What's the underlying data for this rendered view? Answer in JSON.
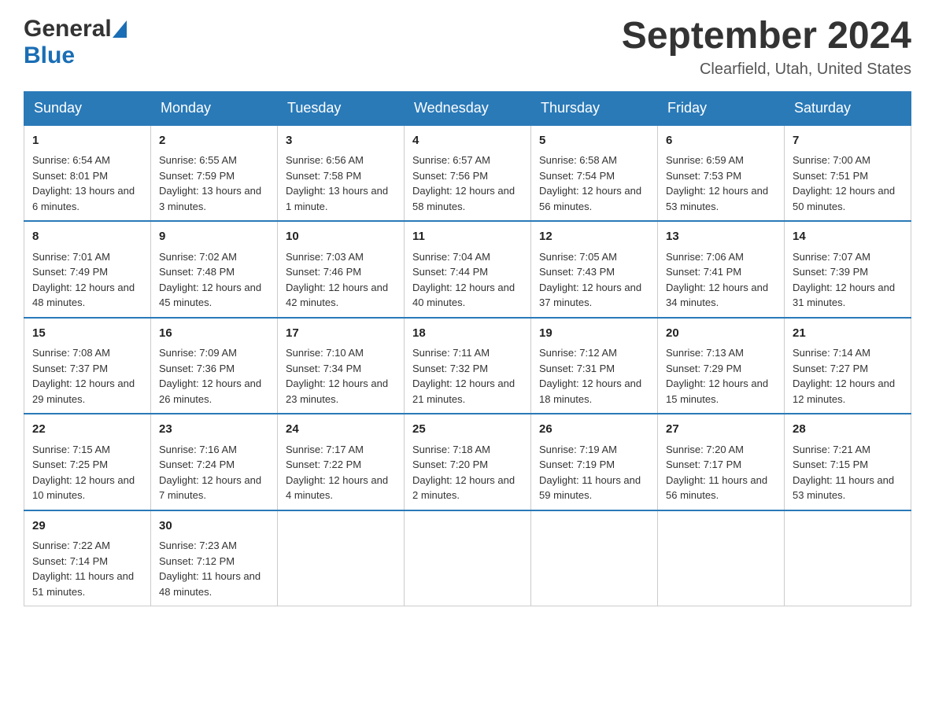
{
  "header": {
    "logo_general": "General",
    "logo_blue": "Blue",
    "title": "September 2024",
    "subtitle": "Clearfield, Utah, United States"
  },
  "days_of_week": [
    "Sunday",
    "Monday",
    "Tuesday",
    "Wednesday",
    "Thursday",
    "Friday",
    "Saturday"
  ],
  "weeks": [
    [
      {
        "day": "1",
        "sunrise": "Sunrise: 6:54 AM",
        "sunset": "Sunset: 8:01 PM",
        "daylight": "Daylight: 13 hours and 6 minutes."
      },
      {
        "day": "2",
        "sunrise": "Sunrise: 6:55 AM",
        "sunset": "Sunset: 7:59 PM",
        "daylight": "Daylight: 13 hours and 3 minutes."
      },
      {
        "day": "3",
        "sunrise": "Sunrise: 6:56 AM",
        "sunset": "Sunset: 7:58 PM",
        "daylight": "Daylight: 13 hours and 1 minute."
      },
      {
        "day": "4",
        "sunrise": "Sunrise: 6:57 AM",
        "sunset": "Sunset: 7:56 PM",
        "daylight": "Daylight: 12 hours and 58 minutes."
      },
      {
        "day": "5",
        "sunrise": "Sunrise: 6:58 AM",
        "sunset": "Sunset: 7:54 PM",
        "daylight": "Daylight: 12 hours and 56 minutes."
      },
      {
        "day": "6",
        "sunrise": "Sunrise: 6:59 AM",
        "sunset": "Sunset: 7:53 PM",
        "daylight": "Daylight: 12 hours and 53 minutes."
      },
      {
        "day": "7",
        "sunrise": "Sunrise: 7:00 AM",
        "sunset": "Sunset: 7:51 PM",
        "daylight": "Daylight: 12 hours and 50 minutes."
      }
    ],
    [
      {
        "day": "8",
        "sunrise": "Sunrise: 7:01 AM",
        "sunset": "Sunset: 7:49 PM",
        "daylight": "Daylight: 12 hours and 48 minutes."
      },
      {
        "day": "9",
        "sunrise": "Sunrise: 7:02 AM",
        "sunset": "Sunset: 7:48 PM",
        "daylight": "Daylight: 12 hours and 45 minutes."
      },
      {
        "day": "10",
        "sunrise": "Sunrise: 7:03 AM",
        "sunset": "Sunset: 7:46 PM",
        "daylight": "Daylight: 12 hours and 42 minutes."
      },
      {
        "day": "11",
        "sunrise": "Sunrise: 7:04 AM",
        "sunset": "Sunset: 7:44 PM",
        "daylight": "Daylight: 12 hours and 40 minutes."
      },
      {
        "day": "12",
        "sunrise": "Sunrise: 7:05 AM",
        "sunset": "Sunset: 7:43 PM",
        "daylight": "Daylight: 12 hours and 37 minutes."
      },
      {
        "day": "13",
        "sunrise": "Sunrise: 7:06 AM",
        "sunset": "Sunset: 7:41 PM",
        "daylight": "Daylight: 12 hours and 34 minutes."
      },
      {
        "day": "14",
        "sunrise": "Sunrise: 7:07 AM",
        "sunset": "Sunset: 7:39 PM",
        "daylight": "Daylight: 12 hours and 31 minutes."
      }
    ],
    [
      {
        "day": "15",
        "sunrise": "Sunrise: 7:08 AM",
        "sunset": "Sunset: 7:37 PM",
        "daylight": "Daylight: 12 hours and 29 minutes."
      },
      {
        "day": "16",
        "sunrise": "Sunrise: 7:09 AM",
        "sunset": "Sunset: 7:36 PM",
        "daylight": "Daylight: 12 hours and 26 minutes."
      },
      {
        "day": "17",
        "sunrise": "Sunrise: 7:10 AM",
        "sunset": "Sunset: 7:34 PM",
        "daylight": "Daylight: 12 hours and 23 minutes."
      },
      {
        "day": "18",
        "sunrise": "Sunrise: 7:11 AM",
        "sunset": "Sunset: 7:32 PM",
        "daylight": "Daylight: 12 hours and 21 minutes."
      },
      {
        "day": "19",
        "sunrise": "Sunrise: 7:12 AM",
        "sunset": "Sunset: 7:31 PM",
        "daylight": "Daylight: 12 hours and 18 minutes."
      },
      {
        "day": "20",
        "sunrise": "Sunrise: 7:13 AM",
        "sunset": "Sunset: 7:29 PM",
        "daylight": "Daylight: 12 hours and 15 minutes."
      },
      {
        "day": "21",
        "sunrise": "Sunrise: 7:14 AM",
        "sunset": "Sunset: 7:27 PM",
        "daylight": "Daylight: 12 hours and 12 minutes."
      }
    ],
    [
      {
        "day": "22",
        "sunrise": "Sunrise: 7:15 AM",
        "sunset": "Sunset: 7:25 PM",
        "daylight": "Daylight: 12 hours and 10 minutes."
      },
      {
        "day": "23",
        "sunrise": "Sunrise: 7:16 AM",
        "sunset": "Sunset: 7:24 PM",
        "daylight": "Daylight: 12 hours and 7 minutes."
      },
      {
        "day": "24",
        "sunrise": "Sunrise: 7:17 AM",
        "sunset": "Sunset: 7:22 PM",
        "daylight": "Daylight: 12 hours and 4 minutes."
      },
      {
        "day": "25",
        "sunrise": "Sunrise: 7:18 AM",
        "sunset": "Sunset: 7:20 PM",
        "daylight": "Daylight: 12 hours and 2 minutes."
      },
      {
        "day": "26",
        "sunrise": "Sunrise: 7:19 AM",
        "sunset": "Sunset: 7:19 PM",
        "daylight": "Daylight: 11 hours and 59 minutes."
      },
      {
        "day": "27",
        "sunrise": "Sunrise: 7:20 AM",
        "sunset": "Sunset: 7:17 PM",
        "daylight": "Daylight: 11 hours and 56 minutes."
      },
      {
        "day": "28",
        "sunrise": "Sunrise: 7:21 AM",
        "sunset": "Sunset: 7:15 PM",
        "daylight": "Daylight: 11 hours and 53 minutes."
      }
    ],
    [
      {
        "day": "29",
        "sunrise": "Sunrise: 7:22 AM",
        "sunset": "Sunset: 7:14 PM",
        "daylight": "Daylight: 11 hours and 51 minutes."
      },
      {
        "day": "30",
        "sunrise": "Sunrise: 7:23 AM",
        "sunset": "Sunset: 7:12 PM",
        "daylight": "Daylight: 11 hours and 48 minutes."
      },
      null,
      null,
      null,
      null,
      null
    ]
  ]
}
